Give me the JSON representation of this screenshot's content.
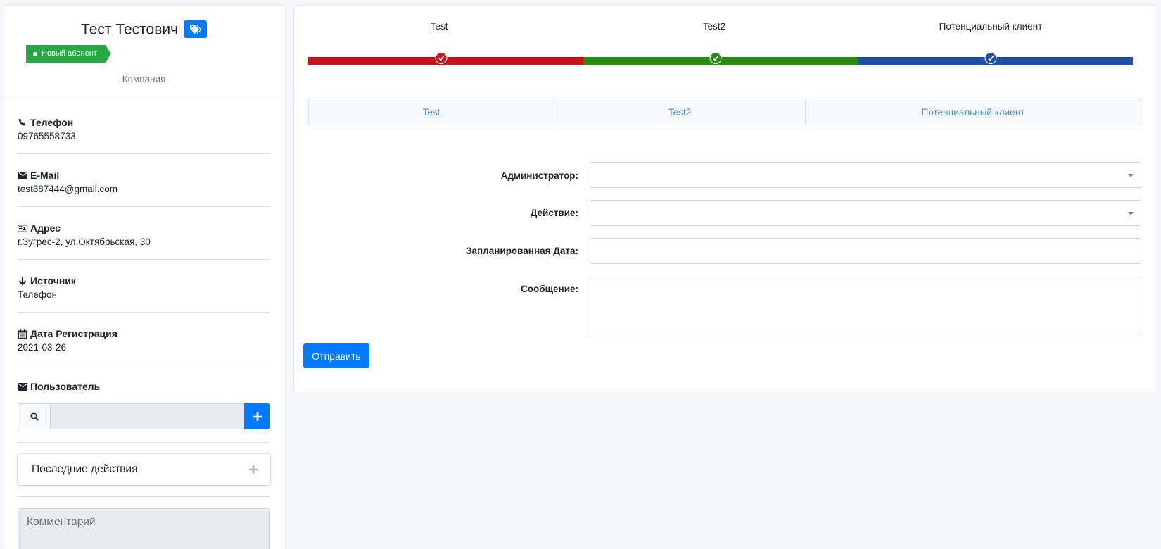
{
  "profile": {
    "name": "Тест Тестович",
    "badge": "Новый абонент",
    "company": "Компания",
    "fields": [
      {
        "icon": "phone-icon",
        "label": "Телефон",
        "value": "09765558733"
      },
      {
        "icon": "envelope-icon",
        "label": "E-Mail",
        "value": "test887444@gmail.com"
      },
      {
        "icon": "id-card-icon",
        "label": "Адрес",
        "value": "г.Зугрес-2, ул.Октябрьская, 30"
      },
      {
        "icon": "arrow-down-icon",
        "label": "Источник",
        "value": "Телефон"
      },
      {
        "icon": "calendar-icon",
        "label": "Дата Регистрация",
        "value": "2021-03-26"
      }
    ],
    "user_label": "Пользователь",
    "recent_actions": "Последние действия",
    "comment_placeholder": "Комментарий"
  },
  "colors": {
    "primary": "#007bff",
    "step1": "#c4161c",
    "step2": "#2a8a12",
    "step3": "#1f4fa6",
    "badge": "#28a745"
  },
  "steps": [
    {
      "label": "Test"
    },
    {
      "label": "Test2"
    },
    {
      "label": "Потенциальный клиент"
    }
  ],
  "tabs": [
    "Test",
    "Test2",
    "Потенциальный клиент"
  ],
  "form": {
    "admin_label": "Администратор:",
    "action_label": "Действие:",
    "date_label": "Запланированная Дата:",
    "message_label": "Сообщение:",
    "submit": "Отправить"
  }
}
